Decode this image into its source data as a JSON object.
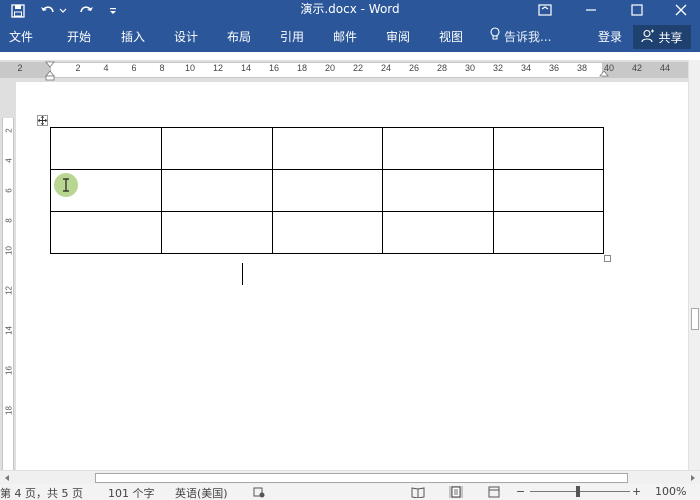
{
  "titlebar": {
    "doc_title": "演示.docx - Word",
    "icons": [
      "save-icon",
      "undo-icon",
      "undo-dropdown-icon",
      "redo-icon",
      "customize-qat-icon",
      "ribbon-display-icon",
      "minimize-icon",
      "maximize-icon",
      "close-icon"
    ]
  },
  "ribbon": {
    "tabs": [
      "文件",
      "开始",
      "插入",
      "设计",
      "布局",
      "引用",
      "邮件",
      "审阅",
      "视图"
    ],
    "tell_me": "告诉我...",
    "login": "登录",
    "share": "共享"
  },
  "ruler": {
    "numbers": [
      "2",
      "2",
      "4",
      "6",
      "8",
      "10",
      "12",
      "14",
      "16",
      "18",
      "20",
      "22",
      "24",
      "26",
      "28",
      "30",
      "32",
      "34",
      "36",
      "38",
      "40",
      "42",
      "44"
    ]
  },
  "vruler": {
    "numbers": [
      "2",
      "4",
      "6",
      "8",
      "10",
      "12",
      "14",
      "16",
      "18"
    ]
  },
  "document": {
    "table": {
      "rows": 3,
      "cols": 5
    }
  },
  "status": {
    "page": "第 4 页，共 5 页",
    "words": "101 个字",
    "language": "英语(美国)",
    "zoom_level": "100%",
    "zoom_minus": "−",
    "zoom_plus": "+"
  },
  "colors": {
    "ribbon_blue": "#2b579a",
    "share_button": "#1e4170"
  }
}
